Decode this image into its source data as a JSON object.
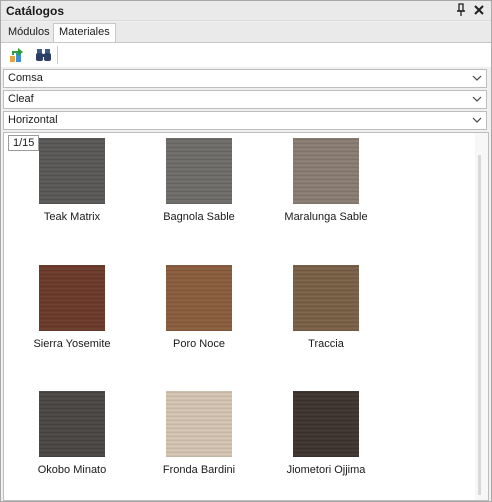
{
  "window": {
    "title": "Catálogos"
  },
  "tabs": [
    {
      "label": "Módulos",
      "active": false
    },
    {
      "label": "Materiales",
      "active": true
    }
  ],
  "toolbar": {
    "buttons": [
      {
        "icon": "refresh-arrow-icon"
      },
      {
        "icon": "binoculars-icon"
      }
    ]
  },
  "filters": {
    "manufacturer": "Comsa",
    "collection": "Cleaf",
    "orientation": "Horizontal"
  },
  "list": {
    "page": "1/15",
    "items": [
      {
        "name": "Teak Matrix",
        "color": "#5a5857"
      },
      {
        "name": "Bagnola Sable",
        "color": "#6f6c69"
      },
      {
        "name": "Maralunga Sable",
        "color": "#8a7d72"
      },
      {
        "name": "Sierra Yosemite",
        "color": "#6b3a2a"
      },
      {
        "name": "Poro Noce",
        "color": "#8a5d3d"
      },
      {
        "name": "Traccia",
        "color": "#7a6047"
      },
      {
        "name": "Okobo Minato",
        "color": "#4a4744"
      },
      {
        "name": "Fronda Bardini",
        "color": "#d4c5b2"
      },
      {
        "name": "Jiometori Ojjima",
        "color": "#3e332f"
      }
    ]
  }
}
